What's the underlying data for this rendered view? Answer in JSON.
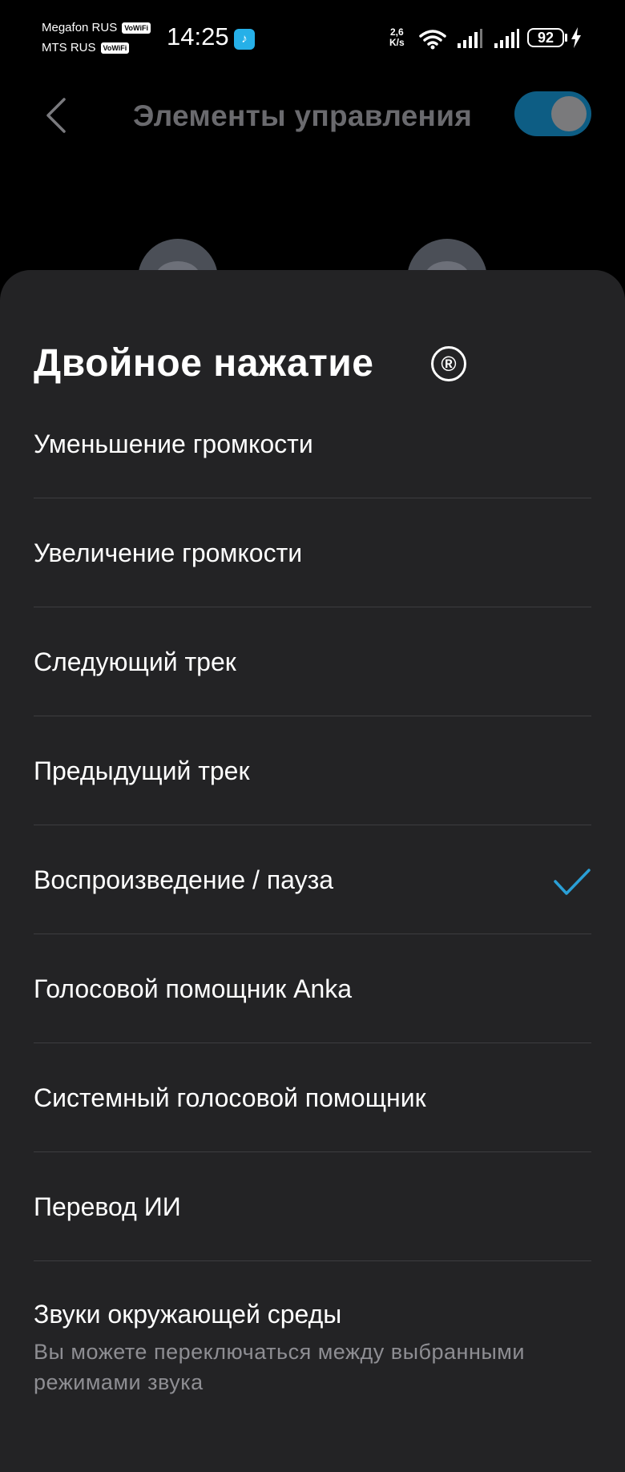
{
  "status_bar": {
    "carrier1": "Megafon RUS",
    "carrier2": "MTS RUS",
    "vowifi": "VoWiFi",
    "time": "14:25",
    "net_speed_value": "2,6",
    "net_speed_unit": "K/s",
    "battery": "92",
    "icons": [
      "wifi-icon",
      "signal-icon",
      "signal-icon",
      "battery-icon",
      "charging-icon"
    ]
  },
  "header": {
    "title": "Элементы управления",
    "toggle_on": true,
    "accent_color": "#0d5d84"
  },
  "sheet": {
    "title": "Двойное нажатие",
    "title_icon": "®",
    "options": [
      {
        "label": "Уменьшение громкости",
        "selected": false
      },
      {
        "label": "Увеличение громкости",
        "selected": false
      },
      {
        "label": "Следующий трек",
        "selected": false
      },
      {
        "label": "Предыдущий трек",
        "selected": false
      },
      {
        "label": "Воспроизведение / пауза",
        "selected": true
      },
      {
        "label": "Голосовой помощник Anka",
        "selected": false
      },
      {
        "label": "Системный голосовой помощник",
        "selected": false
      },
      {
        "label": "Перевод ИИ",
        "selected": false
      },
      {
        "label": "Звуки окружающей среды",
        "selected": false
      }
    ],
    "description": "Вы можете переключаться между выбранными режимами звука",
    "check_color": "#2a9fd6"
  }
}
